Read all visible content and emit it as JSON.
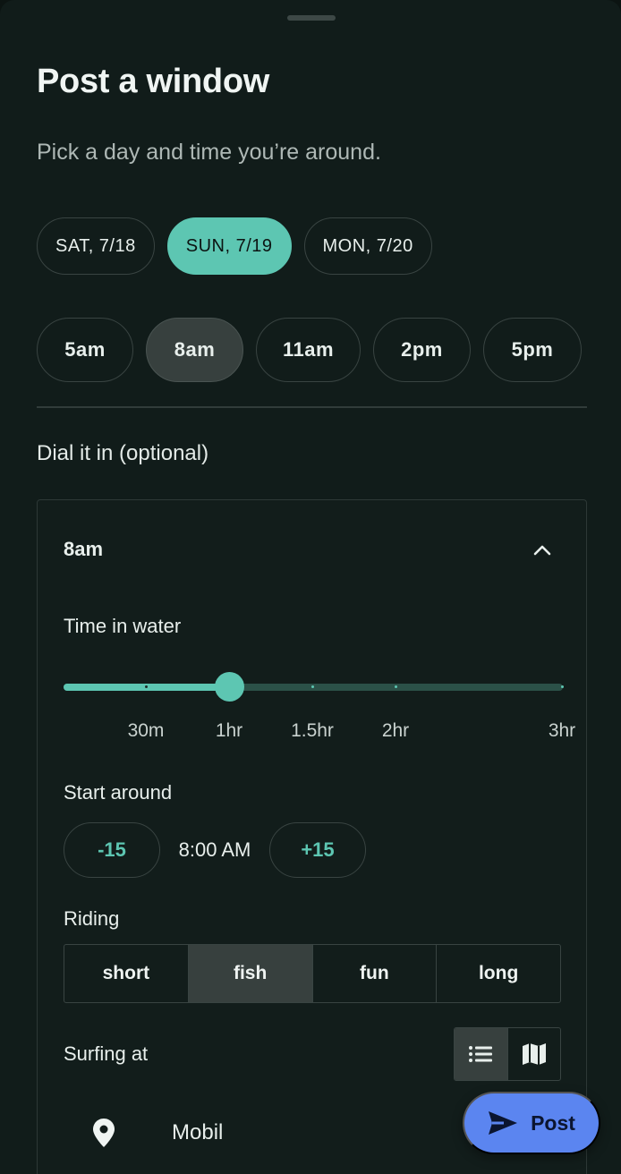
{
  "sheet": {
    "title": "Post a window",
    "subtitle": "Pick a day and time you’re around."
  },
  "days": [
    {
      "label": "SAT, 7/18",
      "selected": false
    },
    {
      "label": "SUN, 7/19",
      "selected": true
    },
    {
      "label": "MON, 7/20",
      "selected": false
    }
  ],
  "times": [
    {
      "label": "5am",
      "selected": false
    },
    {
      "label": "8am",
      "selected": true
    },
    {
      "label": "11am",
      "selected": false
    },
    {
      "label": "2pm",
      "selected": false
    },
    {
      "label": "5pm",
      "selected": false
    }
  ],
  "dial": {
    "label": "Dial it in (optional)",
    "panel_title": "8am",
    "time_in_water": {
      "label": "Time in water",
      "options": [
        "30m",
        "1hr",
        "1.5hr",
        "2hr",
        "3hr"
      ],
      "selected_index": 1
    },
    "start_around": {
      "label": "Start around",
      "minus_label": "-15",
      "value": "8:00 AM",
      "plus_label": "+15"
    },
    "riding": {
      "label": "Riding",
      "options": [
        "short",
        "fish",
        "fun",
        "long"
      ],
      "selected_index": 1
    },
    "surfing_at": {
      "label": "Surfing at",
      "view_mode": "list",
      "location": "Mobil"
    }
  },
  "post_button": {
    "label": "Post"
  },
  "colors": {
    "accent": "#5dc6b2",
    "post": "#5b85f0",
    "background": "#111c1a"
  }
}
